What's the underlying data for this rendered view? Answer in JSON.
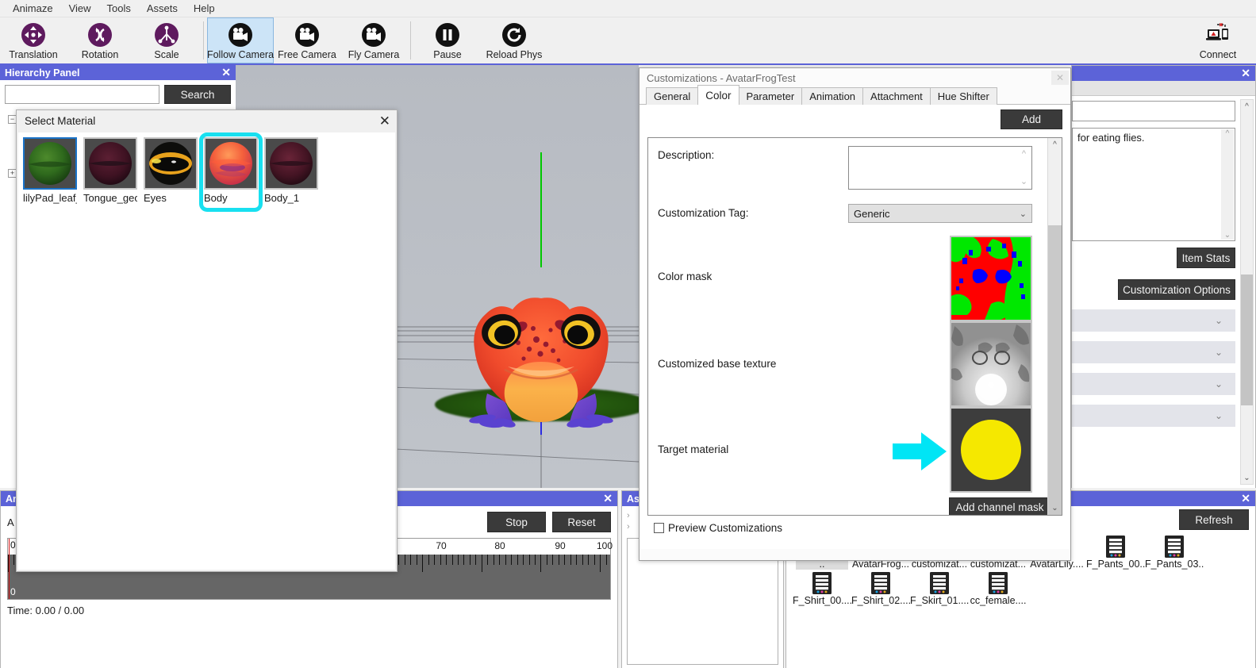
{
  "menubar": {
    "items": [
      "Animaze",
      "View",
      "Tools",
      "Assets",
      "Help"
    ]
  },
  "toolbar": {
    "groups": [
      {
        "buttons": [
          {
            "label": "Translation",
            "icon": "translation-icon",
            "selected": false
          },
          {
            "label": "Rotation",
            "icon": "rotation-icon",
            "selected": false
          },
          {
            "label": "Scale",
            "icon": "scale-icon",
            "selected": false
          }
        ]
      },
      {
        "buttons": [
          {
            "label": "Follow Camera",
            "icon": "camera-icon",
            "selected": true
          },
          {
            "label": "Free Camera",
            "icon": "camera-icon",
            "selected": false
          },
          {
            "label": "Fly Camera",
            "icon": "camera-icon",
            "selected": false
          }
        ]
      },
      {
        "buttons": [
          {
            "label": "Pause",
            "icon": "pause-icon",
            "selected": false
          },
          {
            "label": "Reload Phys",
            "icon": "reload-icon",
            "selected": false
          }
        ]
      }
    ],
    "connect": {
      "label": "Connect",
      "icon": "connect-icon"
    }
  },
  "hierarchy": {
    "title": "Hierarchy Panel",
    "close": "✕",
    "search_value": "",
    "search_placeholder": "",
    "search_button": "Search",
    "tree": [
      {
        "expander": "−",
        "label": "···"
      },
      {
        "expander": "+",
        "label": "···"
      }
    ]
  },
  "select_material": {
    "title": "Select Material",
    "close": "✕",
    "materials": [
      {
        "name": "lilyPad_leaf_",
        "state": "focused"
      },
      {
        "name": "Tongue_geo",
        "state": "normal"
      },
      {
        "name": "Eyes",
        "state": "normal"
      },
      {
        "name": "Body",
        "state": "highlighted"
      },
      {
        "name": "Body_1",
        "state": "normal"
      }
    ]
  },
  "customizations": {
    "title": "Customizations - AvatarFrogTest",
    "close": "✕",
    "tabs": [
      {
        "label": "General",
        "active": false
      },
      {
        "label": "Color",
        "active": true
      },
      {
        "label": "Parameter",
        "active": false
      },
      {
        "label": "Animation",
        "active": false
      },
      {
        "label": "Attachment",
        "active": false
      },
      {
        "label": "Hue Shifter",
        "active": false
      }
    ],
    "add_button": "Add",
    "fields": {
      "description_label": "Description:",
      "description_value": "",
      "tag_label": "Customization Tag:",
      "tag_value": "Generic",
      "color_mask_label": "Color mask",
      "base_texture_label": "Customized base texture",
      "target_material_label": "Target material",
      "add_channel_mask_button": "Add channel mask"
    },
    "preview_checkbox": {
      "label": "Preview Customizations",
      "checked": false
    },
    "annotation": {
      "arrow": "cyan-arrow-right",
      "color": "#00e5f5"
    }
  },
  "right_panel": {
    "close": "✕",
    "name_value": "",
    "description_value": "for eating flies.",
    "item_stats_button": "Item Stats",
    "customization_options_button": "Customization Options",
    "collapsible_sections": 4
  },
  "animation_panel": {
    "title": "Ani",
    "close": "✕",
    "label": "A",
    "stop_button": "Stop",
    "reset_button": "Reset",
    "ruler_ticks": [
      0,
      70,
      80,
      90,
      100
    ],
    "zero_top": "0",
    "zero_bottom": "0",
    "time_text": "Time: 0.00 / 0.00"
  },
  "assets_panel": {
    "title": "As",
    "chevrons": [
      "›",
      "›"
    ]
  },
  "browser_panel": {
    "close": "✕",
    "refresh_button": "Refresh",
    "files": [
      {
        "name": "..",
        "icon": "updir"
      },
      {
        "name": "AvatarFrog...",
        "icon": "file"
      },
      {
        "name": "customizat...",
        "icon": "file"
      },
      {
        "name": "customizat...",
        "icon": "file"
      },
      {
        "name": "AvatarLily....",
        "icon": "file"
      },
      {
        "name": "F_Pants_00...",
        "icon": "file"
      },
      {
        "name": "F_Pants_03...",
        "icon": "file"
      },
      {
        "name": "F_Shirt_00....",
        "icon": "file"
      },
      {
        "name": "F_Shirt_02....",
        "icon": "file"
      },
      {
        "name": "F_Skirt_01....",
        "icon": "file"
      },
      {
        "name": "cc_female....",
        "icon": "file"
      }
    ]
  },
  "colors": {
    "panel_title_bar": "#5c63d8",
    "accent_cyan": "#18e0f0",
    "selection_blue": "#1a73c8",
    "dark_button": "#3a3a3a",
    "toolbar_selected": "#cce4f7",
    "target_material_yellow": "#f5e800"
  }
}
